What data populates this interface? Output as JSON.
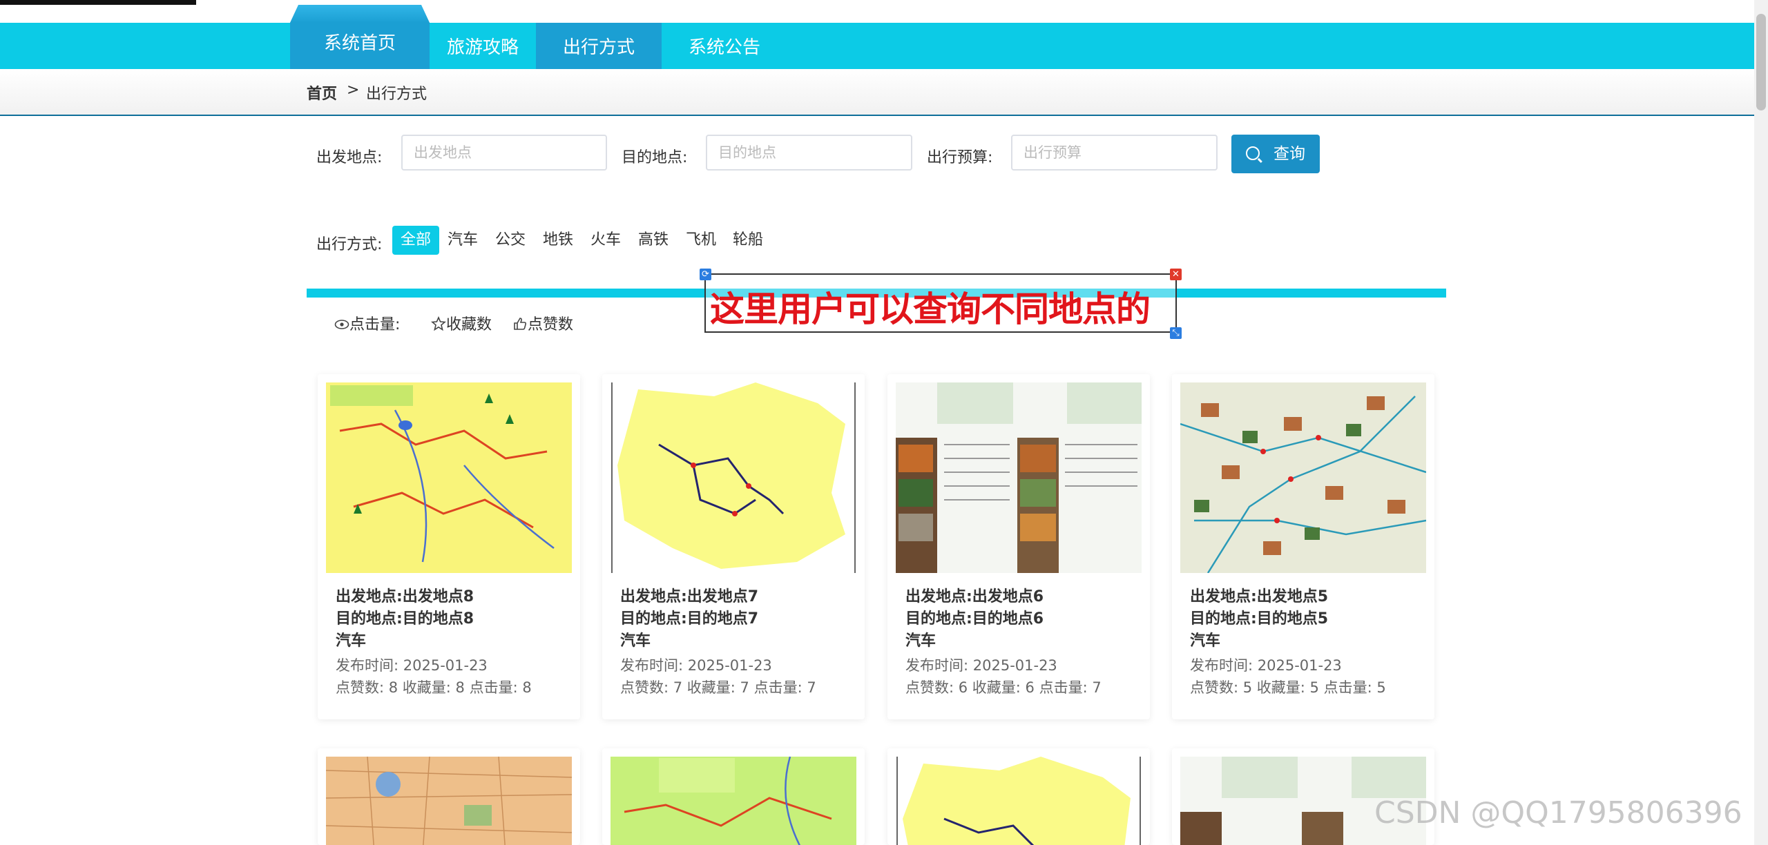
{
  "nav": {
    "home": "系统首页",
    "items": [
      "旅游攻略",
      "出行方式",
      "系统公告"
    ]
  },
  "breadcrumb": {
    "home": "首页",
    "separator": ">",
    "current": "出行方式"
  },
  "search": {
    "from_label": "出发地点:",
    "from_placeholder": "出发地点",
    "to_label": "目的地点:",
    "to_placeholder": "目的地点",
    "budget_label": "出行预算:",
    "budget_placeholder": "出行预算",
    "query_button": "查询"
  },
  "filter": {
    "label": "出行方式:",
    "options": [
      "全部",
      "汽车",
      "公交",
      "地铁",
      "火车",
      "高铁",
      "飞机",
      "轮船"
    ],
    "selected": "全部"
  },
  "sort": {
    "clicks": "点击量:",
    "favorites": "收藏数",
    "likes": "点赞数"
  },
  "annotation": {
    "text": "这里用户可以查询不同地点的"
  },
  "cards": [
    {
      "from": "出发地点:出发地点8",
      "to": "目的地点:目的地点8",
      "mode": "汽车",
      "date": "发布时间:  2025-01-23",
      "stats": "点赞数:  8   收藏量:  8   点击量:  8"
    },
    {
      "from": "出发地点:出发地点7",
      "to": "目的地点:目的地点7",
      "mode": "汽车",
      "date": "发布时间:  2025-01-23",
      "stats": "点赞数:  7   收藏量:  7   点击量:  7"
    },
    {
      "from": "出发地点:出发地点6",
      "to": "目的地点:目的地点6",
      "mode": "汽车",
      "date": "发布时间:  2025-01-23",
      "stats": "点赞数:  6   收藏量:  6   点击量:  7"
    },
    {
      "from": "出发地点:出发地点5",
      "to": "目的地点:目的地点5",
      "mode": "汽车",
      "date": "发布时间:  2025-01-23",
      "stats": "点赞数:  5   收藏量:  5   点击量:  5"
    }
  ],
  "watermark": "CSDN @QQ1795806396",
  "colors": {
    "accent": "#0ccbe6",
    "primary": "#1b90c6",
    "annotation": "#e1151b"
  }
}
